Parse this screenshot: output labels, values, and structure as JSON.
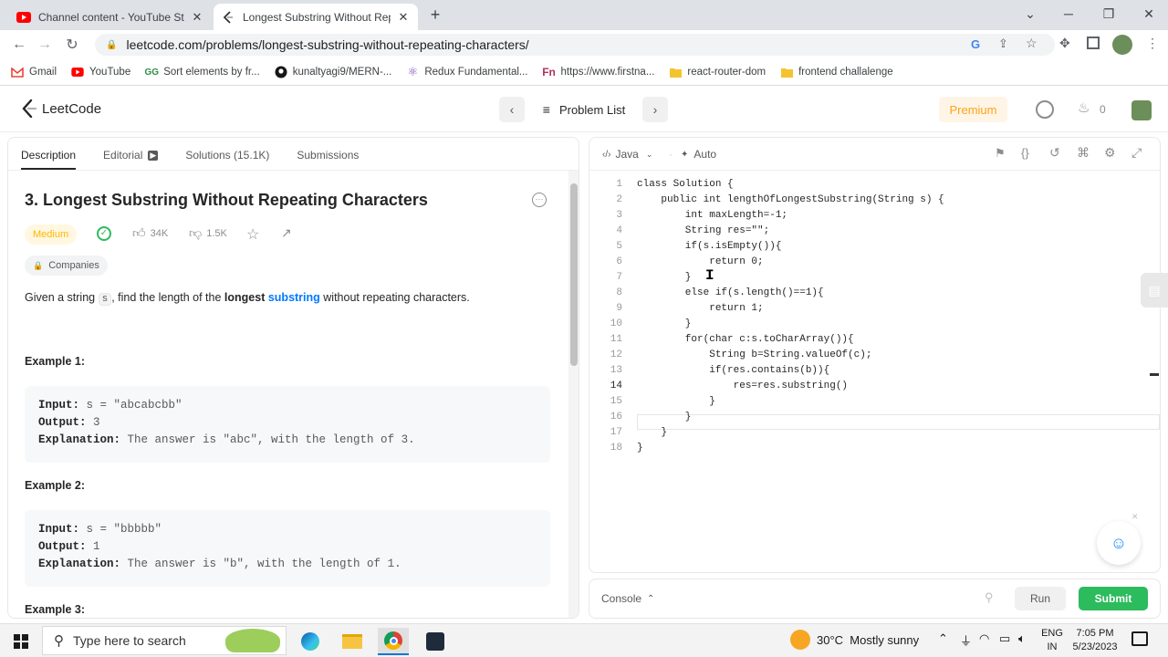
{
  "browser": {
    "tabs": [
      {
        "title": "Channel content - YouTube Studi",
        "active": false,
        "icon": "youtube-icon"
      },
      {
        "title": "Longest Substring Without Repe",
        "active": true,
        "icon": "leetcode-icon"
      }
    ],
    "url": "leetcode.com/problems/longest-substring-without-repeating-characters/",
    "bookmarks": [
      {
        "label": "Gmail",
        "icon": "gmail-icon"
      },
      {
        "label": "YouTube",
        "icon": "youtube-icon"
      },
      {
        "label": "Sort elements by fr...",
        "icon": "geeks-icon"
      },
      {
        "label": "kunaltyagi9/MERN-...",
        "icon": "github-icon"
      },
      {
        "label": "Redux Fundamental...",
        "icon": "redux-icon"
      },
      {
        "label": "https://www.firstna...",
        "icon": "fn-icon"
      },
      {
        "label": "react-router-dom",
        "icon": "folder-icon"
      },
      {
        "label": "frontend challalenge",
        "icon": "folder-icon"
      }
    ]
  },
  "header": {
    "logo": "LeetCode",
    "problem_list": "Problem List",
    "premium": "Premium",
    "streak_count": "0"
  },
  "left": {
    "tabs": [
      "Description",
      "Editorial",
      "Solutions (15.1K)",
      "Submissions"
    ],
    "title": "3. Longest Substring Without Repeating Characters",
    "difficulty": "Medium",
    "likes": "34K",
    "dislikes": "1.5K",
    "companies": "Companies",
    "desc_pre": "Given a string ",
    "desc_code": "s",
    "desc_mid": ", find the length of the ",
    "desc_bold": "longest",
    "desc_link": "substring",
    "desc_post": " without repeating characters.",
    "examples": [
      {
        "heading": "Example 1:",
        "input_label": "Input:",
        "input": " s = \"abcabcbb\"",
        "output_label": "Output:",
        "output": " 3",
        "expl_label": "Explanation:",
        "expl": " The answer is \"abc\", with the length of 3."
      },
      {
        "heading": "Example 2:",
        "input_label": "Input:",
        "input": " s = \"bbbbb\"",
        "output_label": "Output:",
        "output": " 1",
        "expl_label": "Explanation:",
        "expl": " The answer is \"b\", with the length of 1."
      },
      {
        "heading": "Example 3:"
      }
    ]
  },
  "editor": {
    "language": "Java",
    "mode": "Auto",
    "lines": [
      "class Solution {",
      "    public int lengthOfLongestSubstring(String s) {",
      "        int maxLength=-1;",
      "        String res=\"\";",
      "        if(s.isEmpty()){",
      "            return 0;",
      "        }",
      "        else if(s.length()==1){",
      "            return 1;",
      "        }",
      "        for(char c:s.toCharArray()){",
      "            String b=String.valueOf(c);",
      "            if(res.contains(b)){",
      "                res=res.substring()",
      "            }",
      "        }",
      "    }",
      "}"
    ],
    "line_numbers": [
      "1",
      "2",
      "3",
      "4",
      "5",
      "6",
      "7",
      "8",
      "9",
      "10",
      "11",
      "12",
      "13",
      "14",
      "15",
      "16",
      "17",
      "18"
    ]
  },
  "console": {
    "label": "Console",
    "run": "Run",
    "submit": "Submit"
  },
  "taskbar": {
    "search_placeholder": "Type here to search",
    "weather": "30°C  Mostly sunny",
    "lang": "ENG",
    "region": "IN",
    "time": "7:05 PM",
    "date": "5/23/2023"
  },
  "colors": {
    "accent_green": "#2cbb5d",
    "medium": "#ffb800",
    "link": "#007aff"
  }
}
